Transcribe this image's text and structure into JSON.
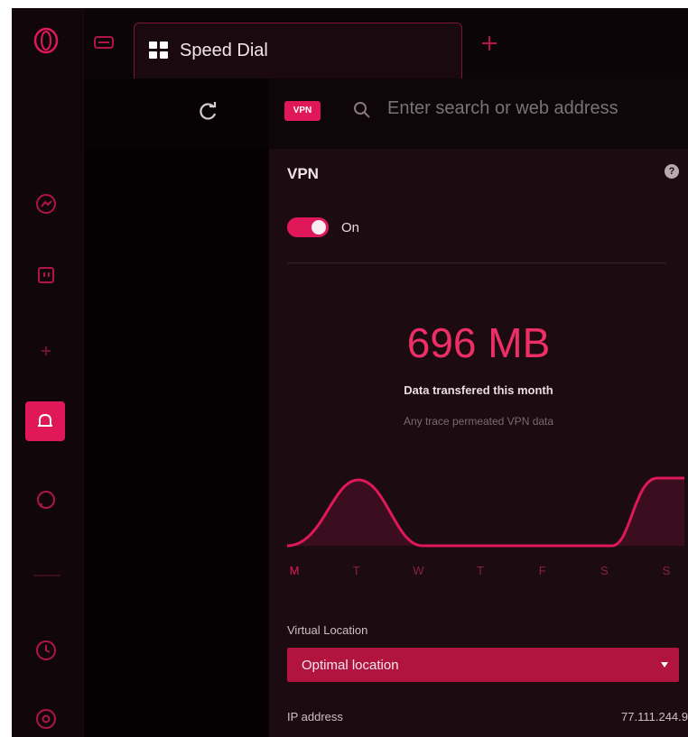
{
  "tabs": [
    {
      "title": "Speed Dial",
      "icon": "speed-dial-grid-icon"
    }
  ],
  "address_bar": {
    "vpn_badge": "VPN",
    "placeholder": "Enter search or web address"
  },
  "sidebar": {
    "items": [
      {
        "name": "opera-logo-icon"
      },
      {
        "name": "messenger-icon"
      },
      {
        "name": "twitch-icon"
      },
      {
        "name": "add-icon"
      },
      {
        "name": "bell-icon",
        "active": true
      },
      {
        "name": "whatsapp-icon"
      },
      {
        "name": "history-icon"
      },
      {
        "name": "settings-icon"
      }
    ]
  },
  "vpn_panel": {
    "title": "VPN",
    "toggle": {
      "state": "On",
      "on": true
    },
    "data_amount": "696 MB",
    "data_label": "Data transfered this month",
    "data_sublabel": "Any trace permeated VPN data",
    "weekday_labels": [
      "M",
      "T",
      "W",
      "T",
      "F",
      "S",
      "S"
    ],
    "virtual_location_label": "Virtual Location",
    "virtual_location_value": "Optimal location",
    "ip_label": "IP address",
    "ip_value": "77.111.244.9"
  },
  "colors": {
    "accent": "#e0185a",
    "background": "#0c0508",
    "panel": "#1c0c12"
  }
}
